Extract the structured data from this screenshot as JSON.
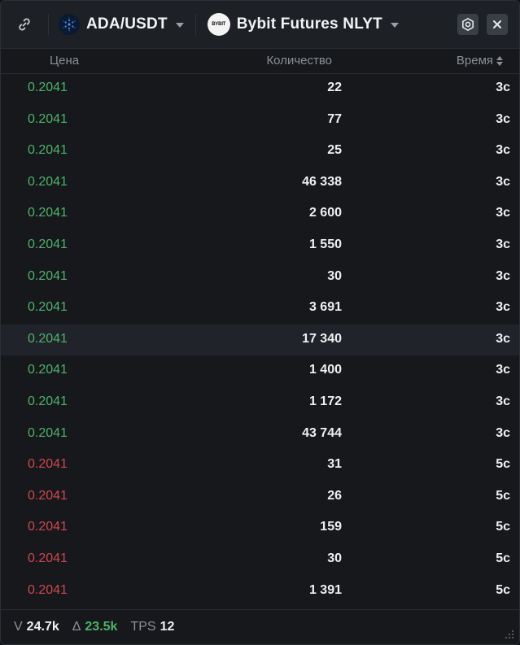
{
  "topbar": {
    "link_icon": "link-icon",
    "symbol": "ADA/USDT",
    "symbol_icon": "cardano-icon",
    "exchange": "Bybit Futures NLYT",
    "exchange_icon_text": "BYBIT",
    "settings_icon": "gear-icon",
    "close_icon": "close-icon"
  },
  "columns": {
    "price": "Цена",
    "quantity": "Количество",
    "time": "Время"
  },
  "trades": [
    {
      "price": "0.2041",
      "qty": "22",
      "time": "3с",
      "side": "buy"
    },
    {
      "price": "0.2041",
      "qty": "77",
      "time": "3с",
      "side": "buy"
    },
    {
      "price": "0.2041",
      "qty": "25",
      "time": "3с",
      "side": "buy"
    },
    {
      "price": "0.2041",
      "qty": "46 338",
      "time": "3с",
      "side": "buy"
    },
    {
      "price": "0.2041",
      "qty": "2 600",
      "time": "3с",
      "side": "buy"
    },
    {
      "price": "0.2041",
      "qty": "1 550",
      "time": "3с",
      "side": "buy"
    },
    {
      "price": "0.2041",
      "qty": "30",
      "time": "3с",
      "side": "buy"
    },
    {
      "price": "0.2041",
      "qty": "3 691",
      "time": "3с",
      "side": "buy"
    },
    {
      "price": "0.2041",
      "qty": "17 340",
      "time": "3с",
      "side": "buy"
    },
    {
      "price": "0.2041",
      "qty": "1 400",
      "time": "3с",
      "side": "buy"
    },
    {
      "price": "0.2041",
      "qty": "1 172",
      "time": "3с",
      "side": "buy"
    },
    {
      "price": "0.2041",
      "qty": "43 744",
      "time": "3с",
      "side": "buy"
    },
    {
      "price": "0.2041",
      "qty": "31",
      "time": "5с",
      "side": "sell"
    },
    {
      "price": "0.2041",
      "qty": "26",
      "time": "5с",
      "side": "sell"
    },
    {
      "price": "0.2041",
      "qty": "159",
      "time": "5с",
      "side": "sell"
    },
    {
      "price": "0.2041",
      "qty": "30",
      "time": "5с",
      "side": "sell"
    },
    {
      "price": "0.2041",
      "qty": "1 391",
      "time": "5с",
      "side": "sell"
    }
  ],
  "footer": {
    "volume_label": "V",
    "volume_value": "24.7k",
    "delta_label": "Δ",
    "delta_value": "23.5k",
    "tps_label": "TPS",
    "tps_value": "12"
  },
  "colors": {
    "buy": "#4fb26a",
    "sell": "#d2464e"
  }
}
